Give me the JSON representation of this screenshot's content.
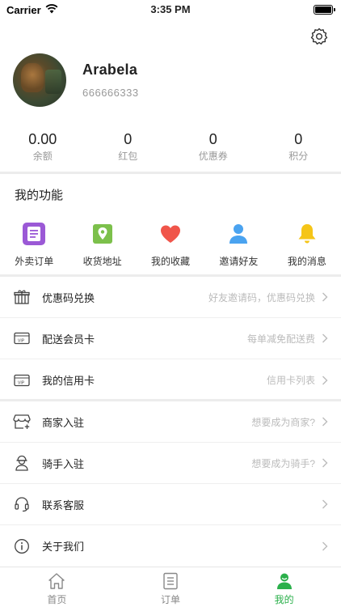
{
  "status_bar": {
    "carrier": "Carrier",
    "time": "3:35 PM"
  },
  "profile": {
    "name": "Arabela",
    "phone": "666666333"
  },
  "stats": [
    {
      "value": "0.00",
      "label": "余额"
    },
    {
      "value": "0",
      "label": "红包"
    },
    {
      "value": "0",
      "label": "优惠券"
    },
    {
      "value": "0",
      "label": "积分"
    }
  ],
  "functions": {
    "title": "我的功能",
    "items": [
      {
        "label": "外卖订单",
        "icon": "order-icon",
        "color": "#9b59d6"
      },
      {
        "label": "收货地址",
        "icon": "map-pin-icon",
        "color": "#7cc04b"
      },
      {
        "label": "我的收藏",
        "icon": "heart-icon",
        "color": "#f0554a"
      },
      {
        "label": "邀请好友",
        "icon": "person-icon",
        "color": "#4aa3f0"
      },
      {
        "label": "我的消息",
        "icon": "bell-icon",
        "color": "#f5c518"
      }
    ]
  },
  "menu_group_1": [
    {
      "label": "优惠码兑换",
      "hint": "好友邀请码，优惠码兑换",
      "icon": "gift-icon"
    },
    {
      "label": "配送会员卡",
      "hint": "每单减免配送费",
      "icon": "vip-card-icon"
    },
    {
      "label": "我的信用卡",
      "hint": "信用卡列表",
      "icon": "credit-card-icon"
    }
  ],
  "menu_group_2": [
    {
      "label": "商家入驻",
      "hint": "想要成为商家?",
      "icon": "store-icon"
    },
    {
      "label": "骑手入驻",
      "hint": "想要成为骑手?",
      "icon": "rider-icon"
    },
    {
      "label": "联系客服",
      "hint": "",
      "icon": "headset-icon"
    },
    {
      "label": "关于我们",
      "hint": "",
      "icon": "info-icon"
    }
  ],
  "tabs": [
    {
      "label": "首页",
      "icon": "home-icon",
      "active": false
    },
    {
      "label": "订单",
      "icon": "order-list-icon",
      "active": false
    },
    {
      "label": "我的",
      "icon": "profile-icon",
      "active": true
    }
  ],
  "colors": {
    "accent": "#2bb04b",
    "divider": "#ececec"
  }
}
